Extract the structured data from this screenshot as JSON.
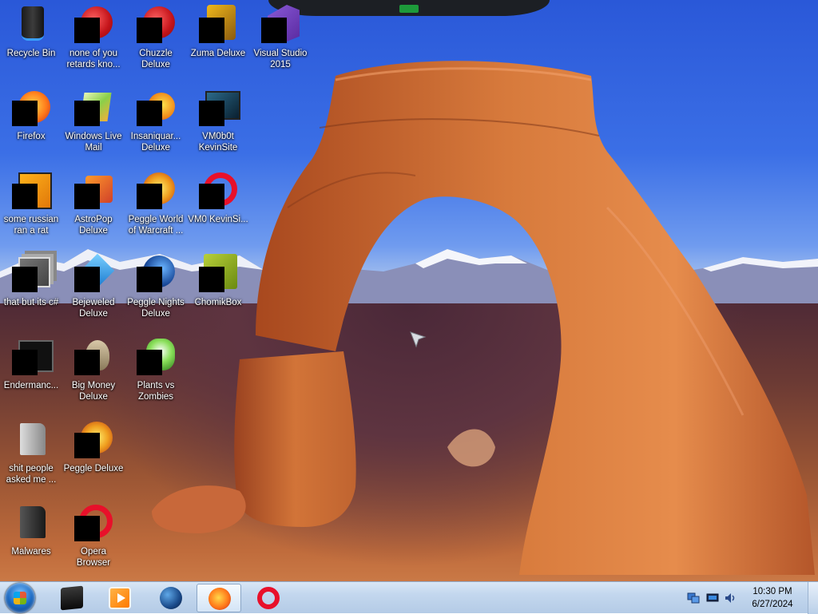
{
  "desktop_icons": [
    {
      "label": "Recycle Bin",
      "icon": "recycle-bin-icon"
    },
    {
      "label": "none of you retards kno...",
      "icon": "red-orb-icon"
    },
    {
      "label": "Chuzzle Deluxe",
      "icon": "chuzzle-icon"
    },
    {
      "label": "Zuma Deluxe",
      "icon": "zuma-icon"
    },
    {
      "label": "Visual Studio 2015",
      "icon": "visual-studio-icon"
    },
    {
      "label": "Firefox",
      "icon": "firefox-icon"
    },
    {
      "label": "Windows Live Mail",
      "icon": "windows-live-mail-icon"
    },
    {
      "label": "Insaniquar... Deluxe",
      "icon": "insaniquarium-icon"
    },
    {
      "label": "VM0b0t KevinSite",
      "icon": "monitor-icon"
    },
    {
      "label": "some russian ran a rat",
      "icon": "orange-file-icon"
    },
    {
      "label": "AstroPop Deluxe",
      "icon": "astropop-icon"
    },
    {
      "label": "Peggle World of Warcraft ...",
      "icon": "peggle-wow-icon"
    },
    {
      "label": "VM0 KevinSi...",
      "icon": "opera-icon"
    },
    {
      "label": "that but its c#",
      "icon": "stacked-windows-icon"
    },
    {
      "label": "Bejeweled Deluxe",
      "icon": "bejeweled-icon"
    },
    {
      "label": "Peggle Nights Deluxe",
      "icon": "peggle-nights-icon"
    },
    {
      "label": "ChomikBox",
      "icon": "chomikbox-icon"
    },
    {
      "label": "Endermanc...",
      "icon": "terminal-icon"
    },
    {
      "label": "Big Money Deluxe",
      "icon": "big-money-icon"
    },
    {
      "label": "Plants vs Zombies",
      "icon": "plants-vs-zombies-icon"
    },
    {
      "label": "shit people asked me ...",
      "icon": "folder-icon"
    },
    {
      "label": "Peggle Deluxe",
      "icon": "peggle-icon"
    },
    {
      "label": "Malwares",
      "icon": "dark-folder-icon"
    },
    {
      "label": "Opera Browser",
      "icon": "opera-icon"
    }
  ],
  "taskbar": {
    "start": {
      "icon": "windows-start-orb-icon"
    },
    "pinned": [
      {
        "name": "terminal",
        "icon": "terminal-icon",
        "active": false
      },
      {
        "name": "media-player",
        "icon": "media-player-icon",
        "active": false
      },
      {
        "name": "globe",
        "icon": "globe-icon",
        "active": false
      },
      {
        "name": "firefox",
        "icon": "firefox-icon",
        "active": true
      },
      {
        "name": "opera",
        "icon": "opera-icon",
        "active": false
      }
    ],
    "tray": {
      "icons": [
        "network-icon",
        "display-icon",
        "volume-icon"
      ],
      "time": "10:30 PM",
      "date": "6/27/2024"
    }
  },
  "colors": {
    "taskbar_bg": "#c3d7ee",
    "opera_red": "#e8102a",
    "sky_blue": "#3b6fe6"
  }
}
